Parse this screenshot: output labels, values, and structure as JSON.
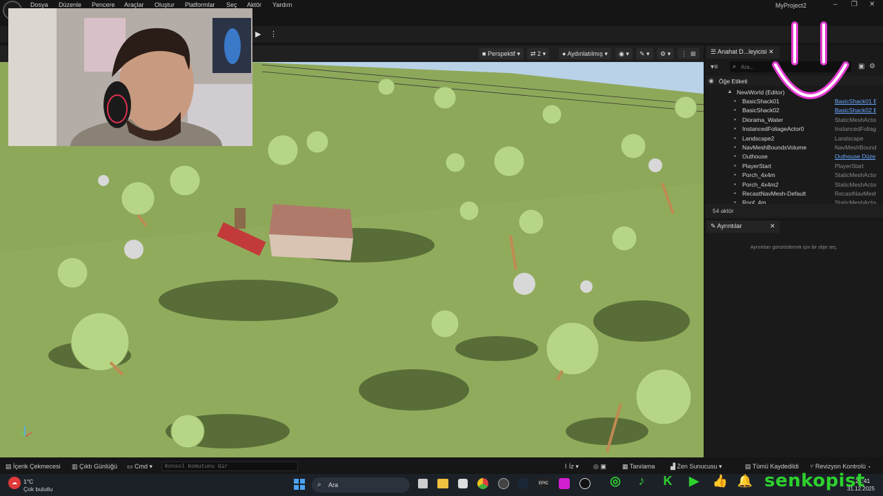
{
  "menu": [
    "Dosya",
    "Düzenle",
    "Pencere",
    "Araçlar",
    "Oluştur",
    "Platformlar",
    "Seç",
    "Aktör",
    "Yardım"
  ],
  "project_title": "MyProject2",
  "viewport": {
    "perspective": "Perspektif",
    "fov": "2",
    "lighting": "Aydınlatılmış"
  },
  "outliner": {
    "tab": "Anahat D...leyicisi",
    "search_placeholder": "Ara...",
    "column_label": "Öğe Etiketi",
    "world": "NewWorld (Editor)",
    "rows": [
      {
        "name": "BasicShack01",
        "type": "BasicShack01 E",
        "link": true
      },
      {
        "name": "BasicShack02",
        "type": "BasicShack02 E",
        "link": true
      },
      {
        "name": "Diorama_Water",
        "type": "StaticMeshActor",
        "link": false
      },
      {
        "name": "InstancedFoliageActor0",
        "type": "InstancedFoliage",
        "link": false
      },
      {
        "name": "Landscape2",
        "type": "Landscape",
        "link": false
      },
      {
        "name": "NavMeshBoundsVolume",
        "type": "NavMeshBound",
        "link": false
      },
      {
        "name": "Outhouse",
        "type": "Outhouse Düze",
        "link": true
      },
      {
        "name": "PlayerStart",
        "type": "PlayerStart",
        "link": false
      },
      {
        "name": "Porch_4x4m",
        "type": "StaticMeshActor",
        "link": false
      },
      {
        "name": "Porch_4x4m2",
        "type": "StaticMeshActor",
        "link": false
      },
      {
        "name": "RecastNavMesh-Default",
        "type": "RecastNavMesh",
        "link": false
      },
      {
        "name": "Roof_4m",
        "type": "StaticMeshActor",
        "link": false
      }
    ],
    "actor_count": "54 aktör"
  },
  "details": {
    "tab": "Ayrıntılar",
    "empty_message": "Ayrıntıları görüntülemek için bir obje seç."
  },
  "bottombar": {
    "content_drawer": "İçerik Çekmecesi",
    "output_log": "Çıktı Günlüğü",
    "cmd": "Cmd",
    "console_placeholder": "Konsol Komutunu Gir",
    "trace": "İz",
    "derived": "Tanılama",
    "zen": "Zen Sunucusu",
    "all_saved": "Tümü Kaydedildi",
    "revision": "Revizyon Kontrolü"
  },
  "taskbar": {
    "temperature": "1°C",
    "weather": "Çok bulutlu",
    "search": "Ara",
    "time": "21:41",
    "date": "31.12.2025"
  },
  "overlay": {
    "handle": "senkopist"
  },
  "colors": {
    "social_green": "#2ed12e",
    "smiley_pink": "#e23ad0",
    "ground": "#8ea85a",
    "sky": "#b9d2e8"
  }
}
